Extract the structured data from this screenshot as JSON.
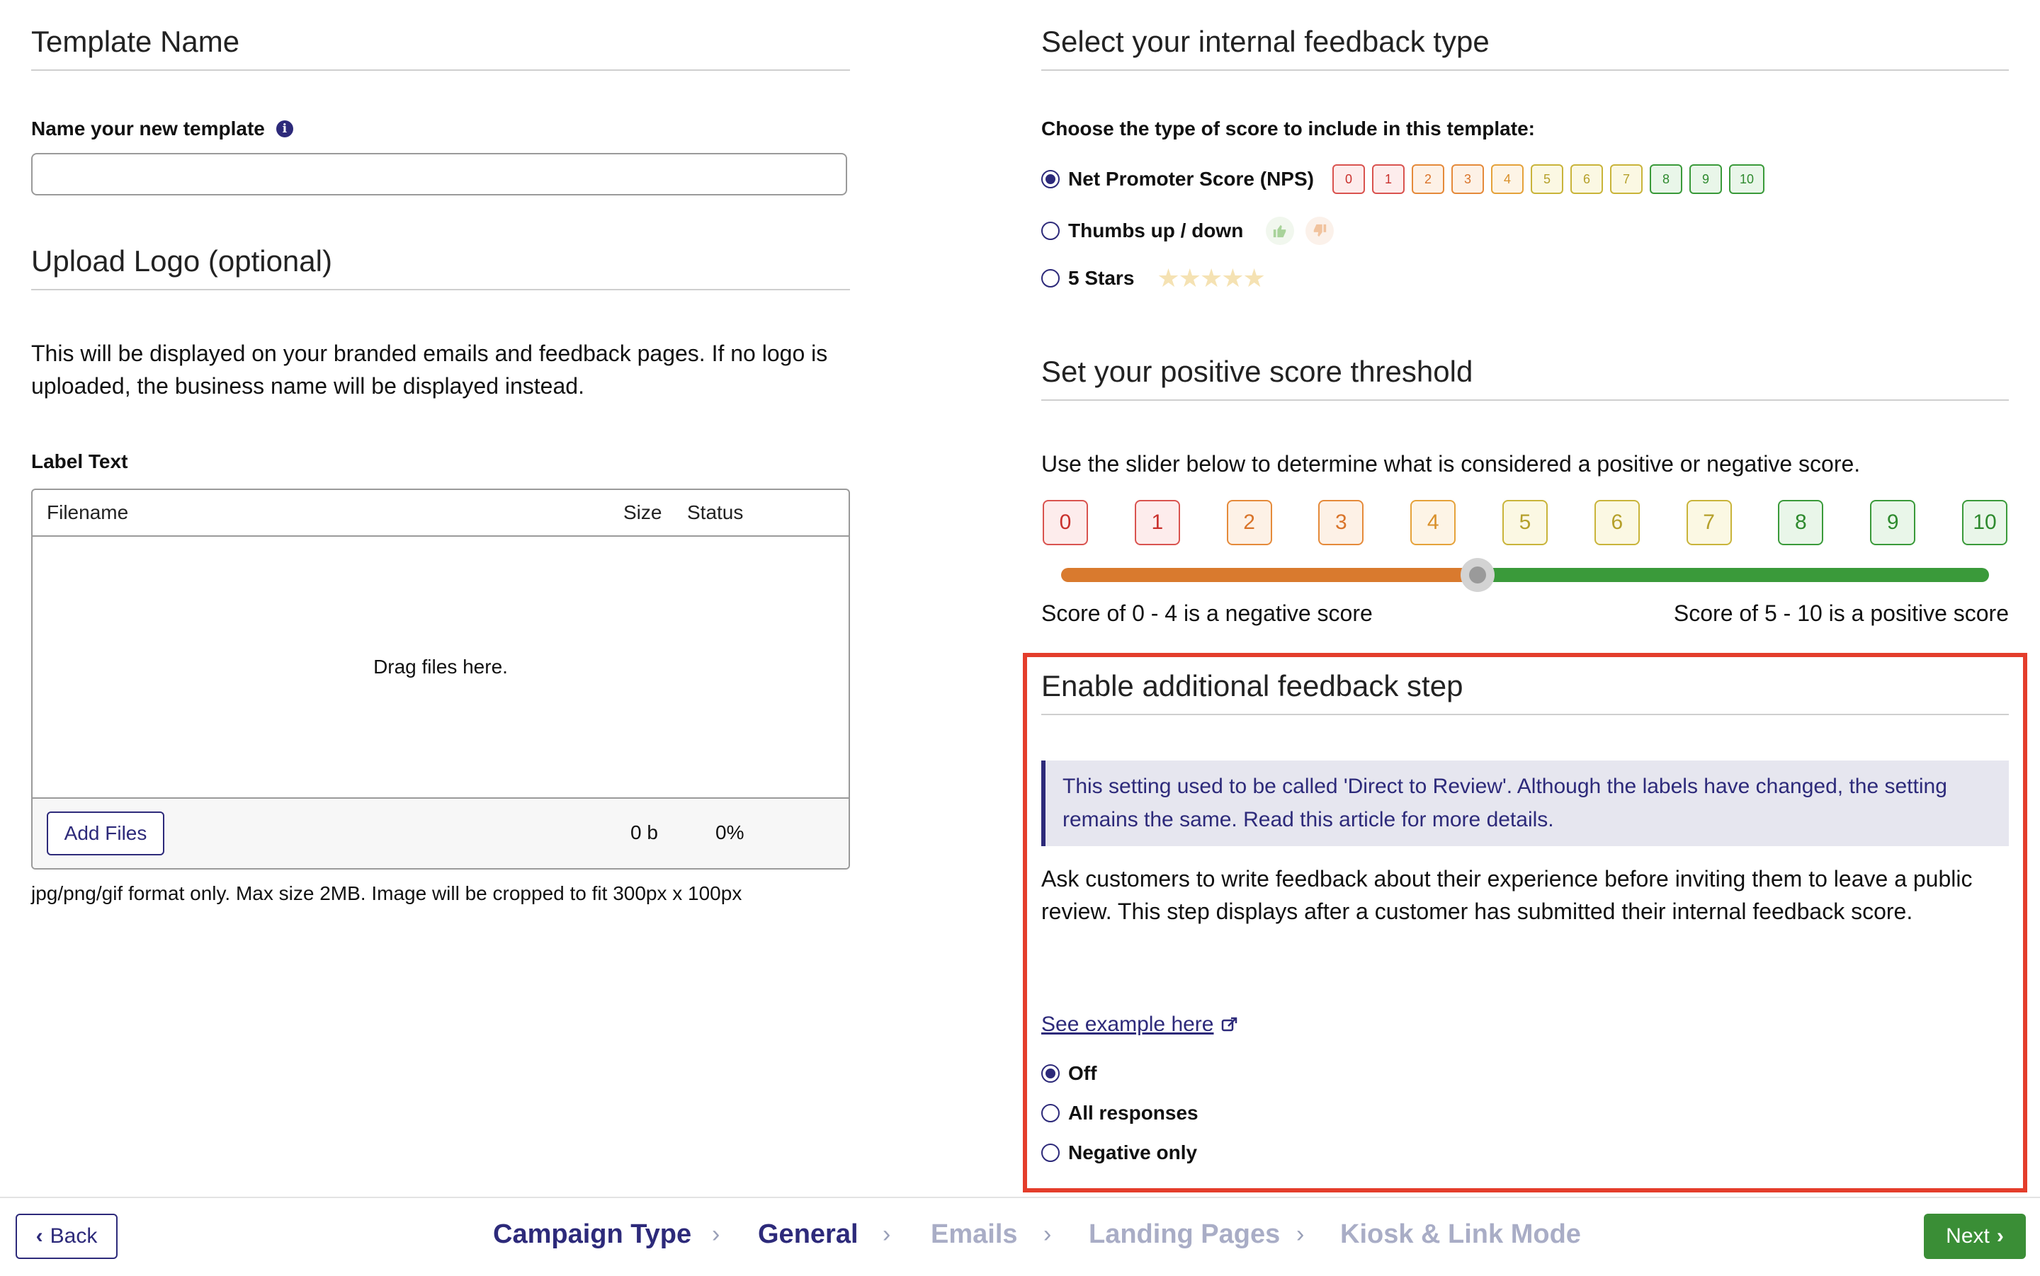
{
  "left": {
    "template_title": "Template Name",
    "name_label": "Name your new template",
    "name_value": "",
    "info_icon": "i",
    "logo_title": "Upload Logo (optional)",
    "logo_desc": "This will be displayed on your branded emails and feedback pages. If no logo is uploaded, the business name will be displayed instead.",
    "label_text": "Label Text",
    "upload": {
      "col_filename": "Filename",
      "col_size": "Size",
      "col_status": "Status",
      "drop_text": "Drag files here.",
      "add_files": "Add Files",
      "total_size": "0 b",
      "total_status": "0%"
    },
    "format_note": "jpg/png/gif format only. Max size 2MB. Image will be cropped to fit 300px x 100px"
  },
  "right": {
    "feedback_title": "Select your internal feedback type",
    "choose_label": "Choose the type of score to include in this template:",
    "options": {
      "nps": "Net Promoter Score (NPS)",
      "thumbs": "Thumbs up / down",
      "stars": "5 Stars",
      "selected": "nps"
    },
    "nps_values": [
      "0",
      "1",
      "2",
      "3",
      "4",
      "5",
      "6",
      "7",
      "8",
      "9",
      "10"
    ],
    "threshold_title": "Set your positive score threshold",
    "slider_desc": "Use the slider below to determine what is considered a positive or negative score.",
    "threshold_value": 4,
    "negative_text": "Score of 0 - 4 is a negative score",
    "positive_text": "Score of 5 - 10 is a positive score",
    "additional_title": "Enable additional feedback step",
    "callout": "This setting used to be called 'Direct to Review'. Although the labels have changed, the setting remains the same. Read this article for more details.",
    "additional_desc": "Ask customers to write feedback about their experience before inviting them to leave a public review. This step displays after a customer has submitted their internal feedback score.",
    "example_link": "See example here",
    "step_options": {
      "off": "Off",
      "all": "All responses",
      "negative": "Negative only",
      "selected": "off"
    }
  },
  "nav": {
    "back": "Back",
    "next": "Next",
    "steps": [
      "Campaign Type",
      "General",
      "Emails",
      "Landing Pages",
      "Kiosk & Link Mode"
    ],
    "current_step": "General"
  },
  "colors": {
    "brand": "#2d2a7a",
    "highlight_border": "#e43d2b",
    "negative": "#d97a2e",
    "positive": "#3a9a3a",
    "next_button": "#3a8e36"
  }
}
